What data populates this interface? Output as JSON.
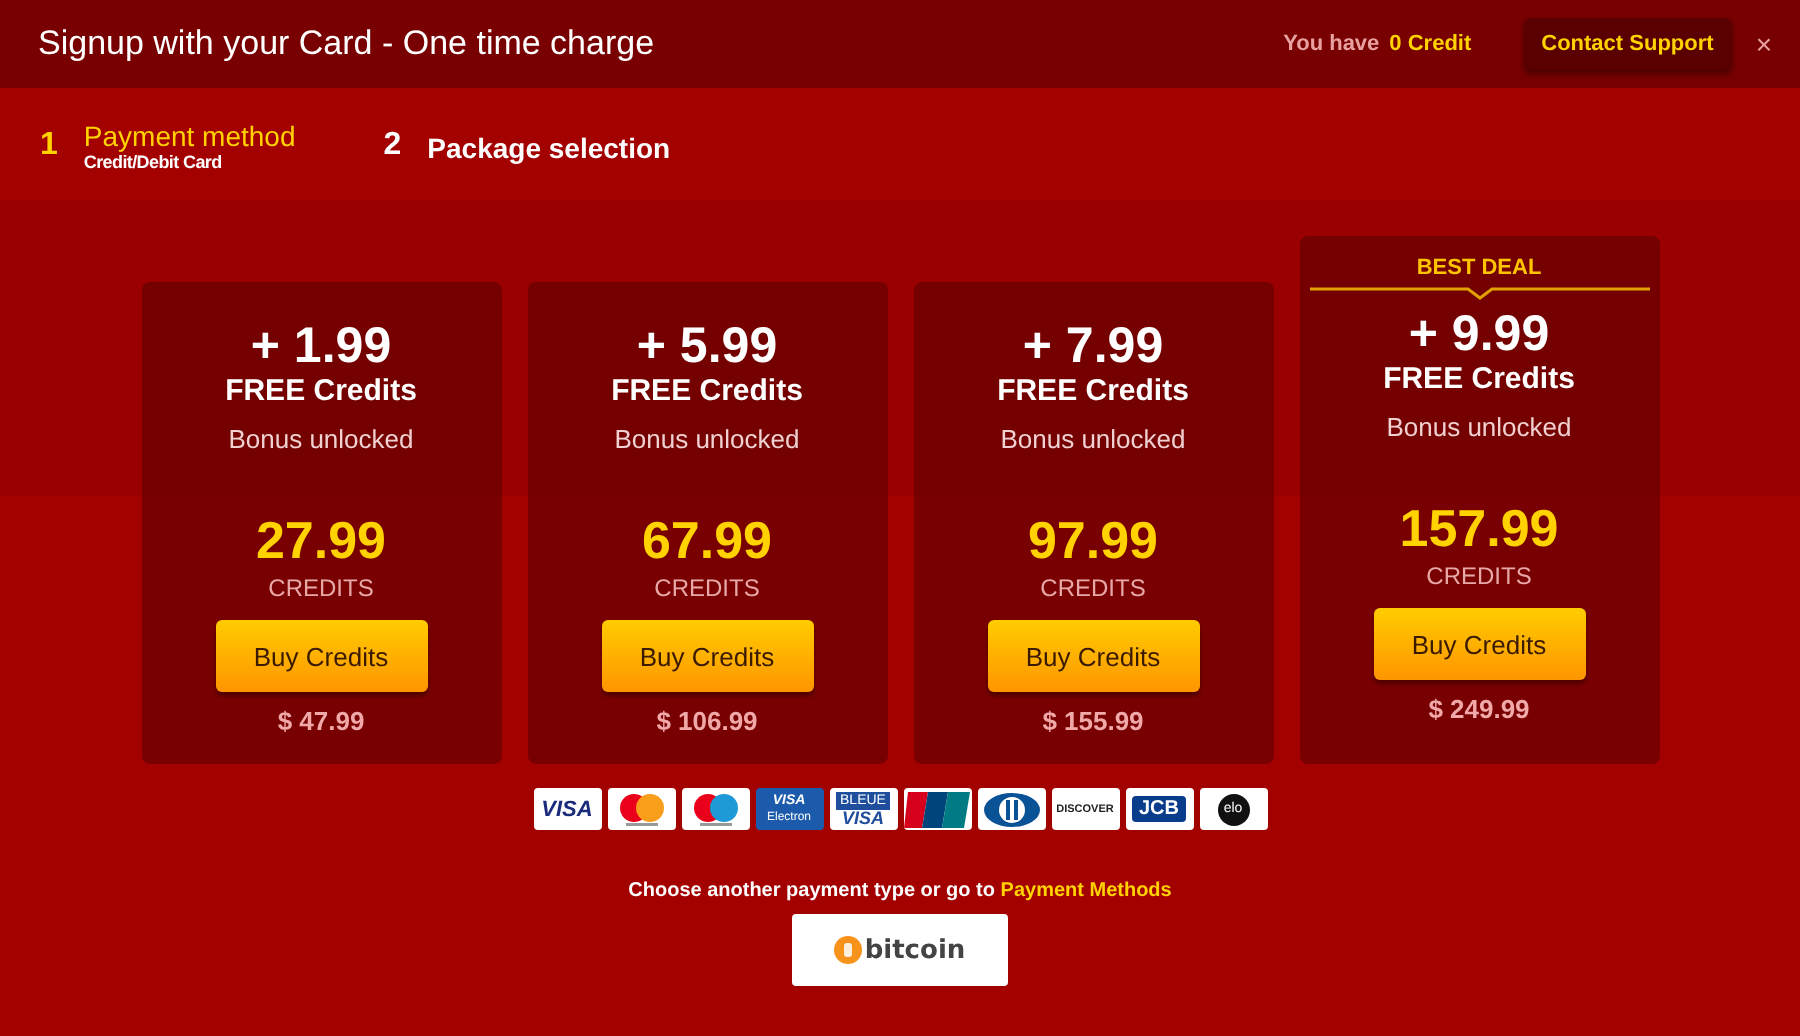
{
  "header": {
    "title": "Signup with your Card - One time charge",
    "balance_label": "You have",
    "balance": "0 Credit",
    "support_button": "Contact Support",
    "close": "×"
  },
  "steps": [
    {
      "number": "1",
      "title": "Payment method",
      "subtitle": "Credit/Debit Card",
      "selected": true
    },
    {
      "number": "2",
      "title": "Package selection",
      "selected": false
    }
  ],
  "packages": [
    {
      "bonus": "+ 1.99",
      "bonus_label": "FREE Credits",
      "note": "Bonus unlocked",
      "credits": "27.99",
      "unit": "CREDITS",
      "button": "Buy Credits",
      "price": "$ 47.99"
    },
    {
      "bonus": "+ 5.99",
      "bonus_label": "FREE Credits",
      "note": "Bonus unlocked",
      "credits": "67.99",
      "unit": "CREDITS",
      "button": "Buy Credits",
      "price": "$ 106.99"
    },
    {
      "bonus": "+ 7.99",
      "bonus_label": "FREE Credits",
      "note": "Bonus unlocked",
      "credits": "97.99",
      "unit": "CREDITS",
      "button": "Buy Credits",
      "price": "$ 155.99"
    },
    {
      "ribbon": "BEST DEAL",
      "bonus": "+ 9.99",
      "bonus_label": "FREE Credits",
      "note": "Bonus unlocked",
      "credits": "157.99",
      "unit": "CREDITS",
      "button": "Buy Credits",
      "price": "$ 249.99"
    }
  ],
  "card_logos": [
    {
      "kind": "wordmark",
      "label": "VISA"
    },
    {
      "kind": "mastercard"
    },
    {
      "kind": "maestro"
    },
    {
      "kind": "electron",
      "label": "VISA",
      "sublabel": "Electron"
    },
    {
      "kind": "bleue",
      "label": "BLEUE",
      "sublabel": "VISA"
    },
    {
      "kind": "stripes"
    },
    {
      "kind": "diners"
    },
    {
      "kind": "discover",
      "label": "DISCOVER"
    },
    {
      "kind": "jcb",
      "label": "JCB"
    },
    {
      "kind": "elo",
      "label": "elo"
    }
  ],
  "alternative": {
    "text": "Choose another payment type or go to",
    "link": "Payment Methods",
    "bitcoin_button": "bitcoin"
  }
}
